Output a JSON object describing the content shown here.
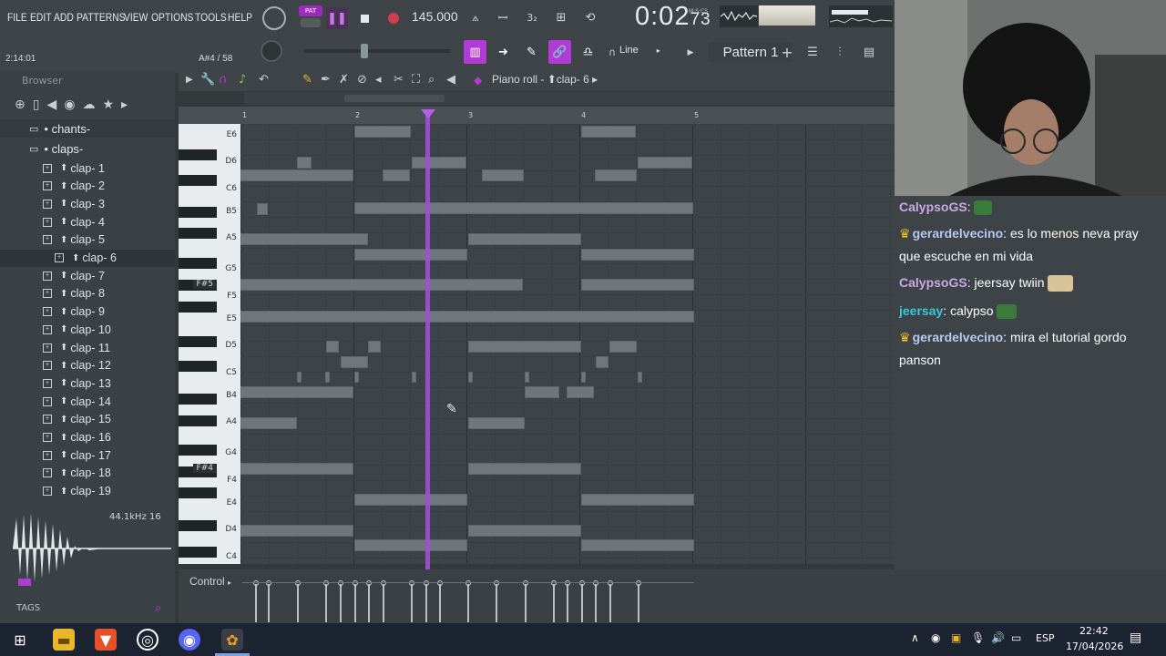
{
  "menu": [
    "FILE",
    "EDIT",
    "ADD",
    "PATTERNS",
    "VIEW",
    "OPTIONS",
    "TOOLS",
    "HELP"
  ],
  "transport": {
    "pat_label": "PAT",
    "tempo": "145.000",
    "time": "0:02",
    "time_ms": "73",
    "time_label": "M:S:CS"
  },
  "status": {
    "song_position": "2:14:01",
    "note_hint": "A#4 / 58"
  },
  "toolbar": {
    "snap_mode": "Line",
    "pattern_name": "Pattern 1"
  },
  "browser": {
    "title": "Browser",
    "folders": [
      "• chants-",
      "• claps-"
    ],
    "items": [
      "clap- 1",
      "clap- 2",
      "clap- 3",
      "clap- 4",
      "clap- 5",
      "clap- 6",
      "clap- 7",
      "clap- 8",
      "clap- 9",
      "clap- 10",
      "clap- 11",
      "clap- 12",
      "clap- 13",
      "clap- 14",
      "clap- 15",
      "clap- 16",
      "clap- 17",
      "clap- 18",
      "clap- 19"
    ],
    "selected_index": 5,
    "sample_info": "44.1kHz 16",
    "tags_label": "TAGS"
  },
  "piano_roll": {
    "title": "Piano roll - ",
    "instrument": "clap- 6",
    "bars": [
      "1",
      "2",
      "3",
      "4",
      "5"
    ],
    "keys": [
      {
        "label": "E6"
      },
      {
        "label": "D6"
      },
      {
        "label": "C6"
      },
      {
        "label": "B5"
      },
      {
        "label": "A5"
      },
      {
        "label": "G5"
      },
      {
        "label": "F#5"
      },
      {
        "label": "F5"
      },
      {
        "label": "E5"
      },
      {
        "label": "D5"
      },
      {
        "label": "C5"
      },
      {
        "label": "B4"
      },
      {
        "label": "A4"
      },
      {
        "label": "G4"
      },
      {
        "label": "F#4"
      },
      {
        "label": "F4"
      },
      {
        "label": "E4"
      },
      {
        "label": "D4"
      },
      {
        "label": "C4"
      }
    ],
    "control_label": "Control"
  },
  "chat": [
    {
      "user": "CalypsoGS",
      "color": "#c9a8e8",
      "text": "",
      "crown": false
    },
    {
      "user": "gerardelvecino",
      "color": "#b6c8f2",
      "text": "es lo menos neva pray que escuche en mi vida",
      "crown": true
    },
    {
      "user": "CalypsoGS",
      "color": "#c9a8e8",
      "text": "jeersay twiin",
      "crown": false
    },
    {
      "user": "jeersay",
      "color": "#35c8d8",
      "text": "calypso",
      "crown": false
    },
    {
      "user": "gerardelvecino",
      "color": "#b6c8f2",
      "text": "mira el tutorial gordo panson",
      "crown": true
    }
  ],
  "taskbar": {
    "lang": "ESP",
    "time": "22:42",
    "date": "17/04/2026"
  },
  "colors": {
    "accent": "#a14fd6",
    "toolbar_active": "#b23ad6"
  }
}
